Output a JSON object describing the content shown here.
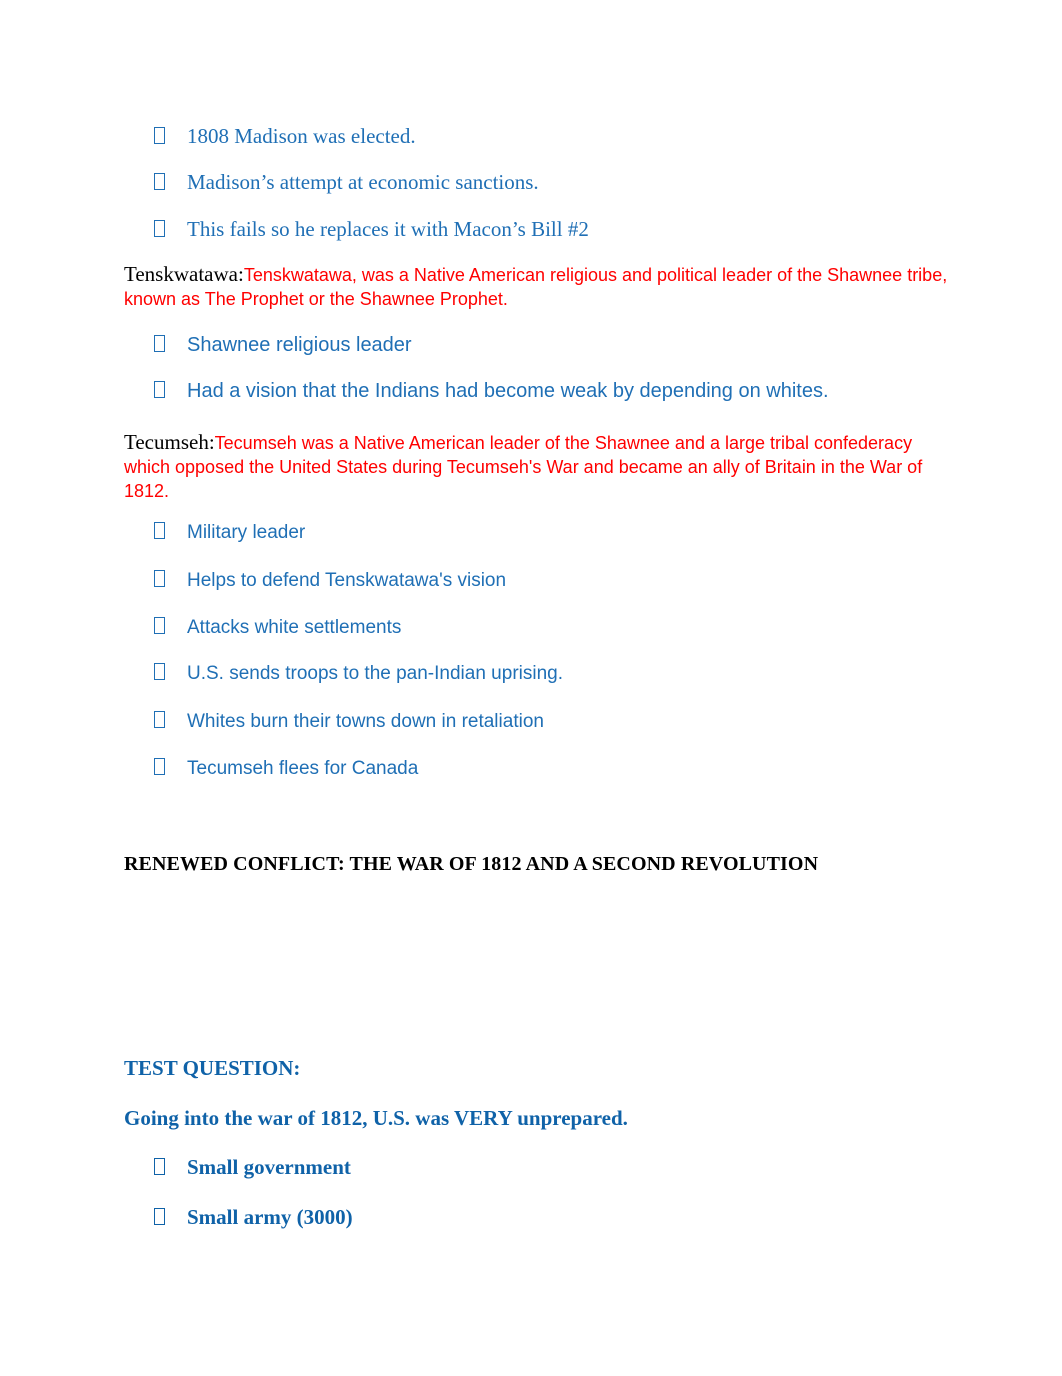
{
  "document": {
    "background_color": "#ffffff",
    "colors": {
      "blue": "#1F6FB5",
      "blue_dark": "#0F62A8",
      "red": "#FF0000",
      "black": "#000000"
    }
  },
  "madison_bullets": [
    {
      "marker": "tofu-box-bullet",
      "text": "1808 Madison was elected."
    },
    {
      "marker": "tofu-box-bullet",
      "text": "Madison’s attempt at economic sanctions."
    },
    {
      "marker": "tofu-box-bullet",
      "text": "This fails so he replaces it with Macon’s Bill #2"
    }
  ],
  "tenskwatawa": {
    "term": "Tenskwatawa:",
    "definition": "Tenskwatawa, was a Native American religious and political leader of the Shawnee tribe, known as The Prophet or the Shawnee Prophet.",
    "bullets": [
      {
        "marker": "tofu-box-bullet",
        "text": "Shawnee religious leader"
      },
      {
        "marker": "tofu-box-bullet",
        "text": "Had a vision that the Indians had become weak by depending on whites."
      }
    ]
  },
  "tecumseh": {
    "term": "Tecumseh:",
    "definition": "Tecumseh was a Native American leader of the Shawnee and a large tribal confederacy which opposed the United States during Tecumseh's War and became an ally of Britain in the War of 1812.",
    "bullets": [
      {
        "marker": "tofu-box-bullet",
        "text": "Military leader"
      },
      {
        "marker": "tofu-box-bullet",
        "text": "Helps to defend Tenskwatawa's vision"
      },
      {
        "marker": "tofu-box-bullet",
        "text": "Attacks white settlements"
      },
      {
        "marker": "tofu-box-bullet",
        "text": "U.S. sends troops to the pan-Indian uprising."
      },
      {
        "marker": "tofu-box-bullet",
        "text": "Whites burn their towns down in retaliation"
      },
      {
        "marker": "tofu-box-bullet",
        "text": "Tecumseh flees for Canada"
      }
    ]
  },
  "section_heading": "RENEWED CONFLICT: THE WAR OF 1812 AND A SECOND REVOLUTION",
  "test_question": {
    "label": "TEST QUESTION:",
    "statement": "Going into the war of 1812, U.S. was VERY unprepared.",
    "bullets": [
      {
        "marker": "tofu-box-bullet",
        "text": "Small government"
      },
      {
        "marker": "tofu-box-bullet",
        "text": "Small army (3000)"
      }
    ]
  }
}
